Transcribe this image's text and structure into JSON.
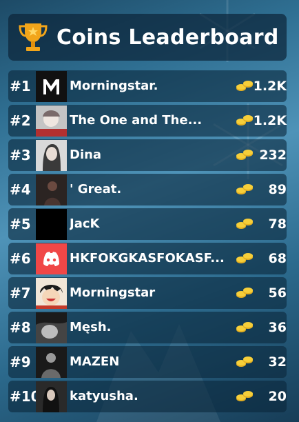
{
  "header": {
    "title": "Coins Leaderboard"
  },
  "leaderboard": [
    {
      "rank": "#1",
      "name": "Morningstar.",
      "coins": "1.2K",
      "avatar": "monogram-logo"
    },
    {
      "rank": "#2",
      "name": "The One and The...",
      "coins": "1.2K",
      "avatar": "anime-girl-portrait"
    },
    {
      "rank": "#3",
      "name": "Dina",
      "coins": "232",
      "avatar": "woman-portrait"
    },
    {
      "rank": "#4",
      "name": "'  Great.",
      "coins": "89",
      "avatar": "dark-photo"
    },
    {
      "rank": "#5",
      "name": "JacK",
      "coins": "78",
      "avatar": "black-square"
    },
    {
      "rank": "#6",
      "name": "HKFOKGKASFOKASF...",
      "coins": "68",
      "avatar": "discord-logo"
    },
    {
      "rank": "#7",
      "name": "Morningstar",
      "coins": "56",
      "avatar": "anime-pirate"
    },
    {
      "rank": "#8",
      "name": "Męsh.",
      "coins": "36",
      "avatar": "monochrome-photo"
    },
    {
      "rank": "#9",
      "name": "MAZEN",
      "coins": "32",
      "avatar": "dark-portrait"
    },
    {
      "rank": "#10",
      "name": "katyusha.",
      "coins": "20",
      "avatar": "anime-dark-girl"
    }
  ],
  "colors": {
    "trophy": "#f2a51a",
    "discord": "#f04747",
    "panel": "#0c263a"
  },
  "icons": {
    "trophy": "trophy-icon",
    "coin": "coin-stack-icon"
  }
}
